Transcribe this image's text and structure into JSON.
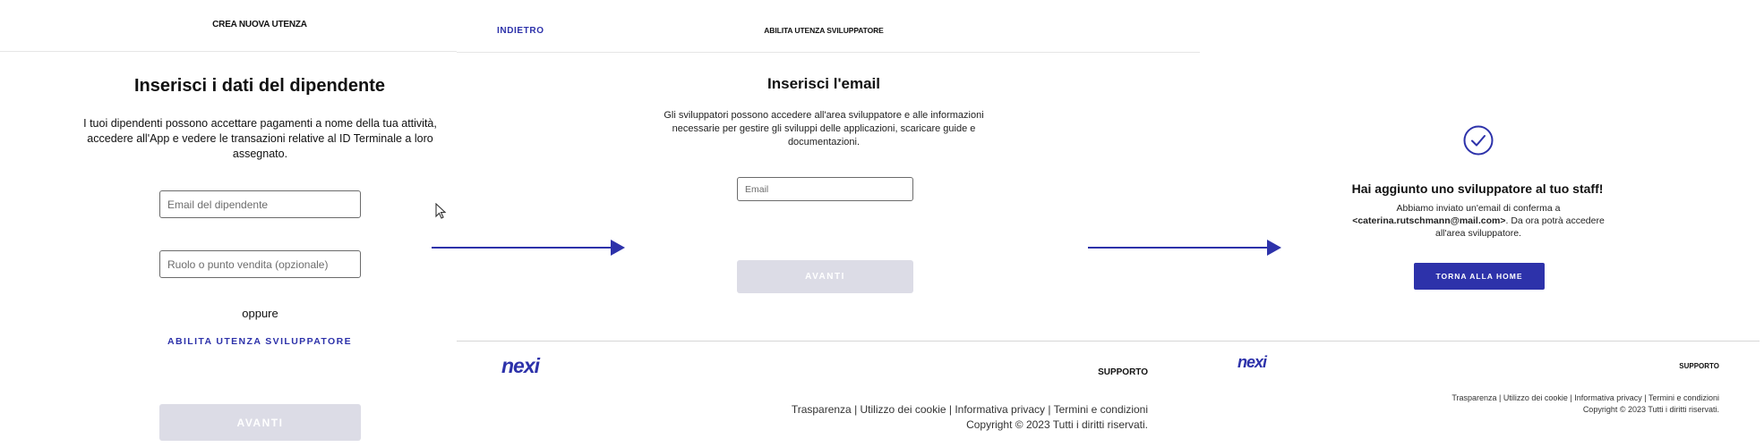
{
  "colors": {
    "accent": "#2d32aa",
    "disabled_button": "#dcdce6",
    "field_border": "#6b6b6b"
  },
  "screen1": {
    "header_title": "CREA NUOVA UTENZA",
    "title": "Inserisci i dati del dipendente",
    "description": "I tuoi dipendenti possono accettare pagamenti a nome della tua attività, accedere all'App e vedere le transazioni relative al ID Terminale a loro assegnato.",
    "email_placeholder": "Email del dipendente",
    "role_placeholder": "Ruolo o punto vendita (opzionale)",
    "or_label": "oppure",
    "developer_link": "ABILITA UTENZA SVILUPPATORE",
    "next_button": "AVANTI"
  },
  "screen2": {
    "back_link": "INDIETRO",
    "header_title": "ABILITA UTENZA SVILUPPATORE",
    "title": "Inserisci l'email",
    "description": "Gli sviluppatori possono accedere all'area sviluppatore e alle informazioni necessarie per gestire gli sviluppi delle applicazioni, scaricare guide e documentazioni.",
    "email_placeholder": "Email",
    "next_button": "AVANTI",
    "footer": {
      "logo": "nexi",
      "support": "SUPPORTO",
      "links": "Trasparenza  |   Utilizzo dei cookie | Informativa privacy | Termini e condizioni",
      "copyright": "Copyright © 2023 Tutti i diritti riservati."
    }
  },
  "screen3": {
    "check_icon": "check-circle-icon",
    "title": "Hai aggiunto uno sviluppatore al tuo staff!",
    "message_line1": "Abbiamo inviato un'email di conferma a",
    "message_email": "<caterina.rutschmann@mail.com>",
    "message_line2": ". Da ora potrà accedere all'area sviluppatore.",
    "home_button": "TORNA ALLA HOME",
    "footer": {
      "logo": "nexi",
      "support": "SUPPORTO",
      "links": "Trasparenza  |   Utilizzo dei cookie | Informativa privacy | Termini e condizioni",
      "copyright": "Copyright © 2023 Tutti i diritti riservati."
    }
  }
}
